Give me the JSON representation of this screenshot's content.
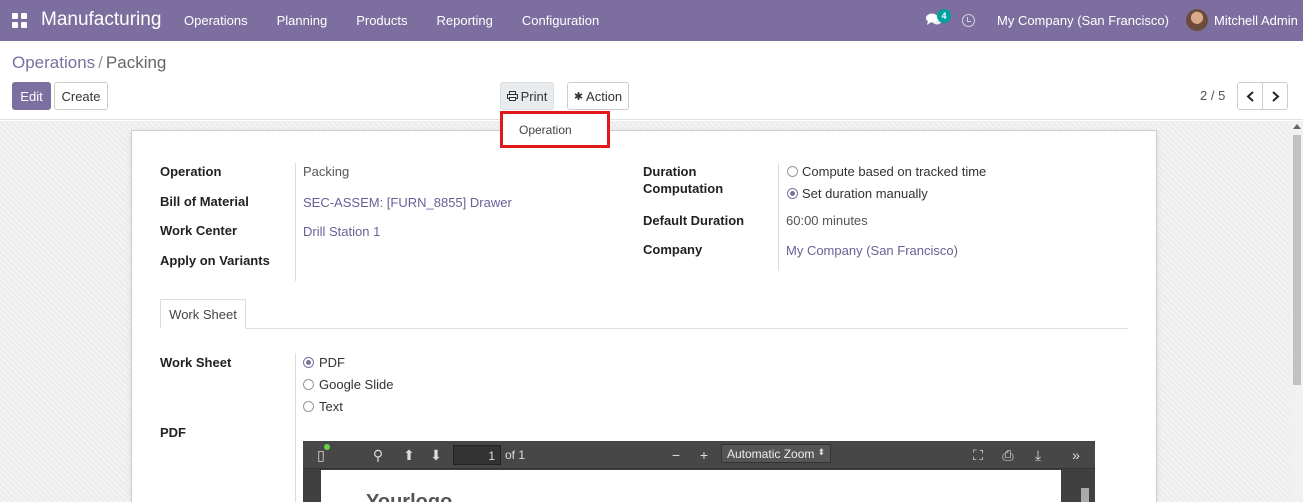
{
  "navbar": {
    "app_title": "Manufacturing",
    "menu": [
      "Operations",
      "Planning",
      "Products",
      "Reporting",
      "Configuration"
    ],
    "chat_count": "4",
    "company": "My Company (San Francisco)",
    "user": "Mitchell Admin"
  },
  "breadcrumb": {
    "parent": "Operations",
    "separator": "/",
    "current": "Packing"
  },
  "toolbar": {
    "edit": "Edit",
    "create": "Create",
    "print": "Print",
    "action": "Action"
  },
  "pager": {
    "value": "2 / 5"
  },
  "print_menu": {
    "items": [
      "Operation"
    ]
  },
  "form": {
    "operation_label": "Operation",
    "operation_value": "Packing",
    "bom_label": "Bill of Material",
    "bom_value": "SEC-ASSEM: [FURN_8855] Drawer",
    "workcenter_label": "Work Center",
    "workcenter_value": "Drill Station 1",
    "variants_label": "Apply on Variants",
    "duration_label_1": "Duration",
    "duration_label_2": "Computation",
    "duration_options": [
      "Compute based on tracked time",
      "Set duration manually"
    ],
    "duration_selected": "Set duration manually",
    "default_duration_label": "Default Duration",
    "default_duration_value": "60:00 minutes",
    "company_label": "Company",
    "company_value": "My Company (San Francisco)"
  },
  "tabs": [
    "Work Sheet"
  ],
  "worksheet": {
    "label": "Work Sheet",
    "options": [
      "PDF",
      "Google Slide",
      "Text"
    ],
    "selected": "PDF",
    "pdf_label": "PDF"
  },
  "pdf_viewer": {
    "page": "1",
    "of_label": "of 1",
    "zoom": "Automatic Zoom",
    "logo_text": "Yourlogo"
  }
}
